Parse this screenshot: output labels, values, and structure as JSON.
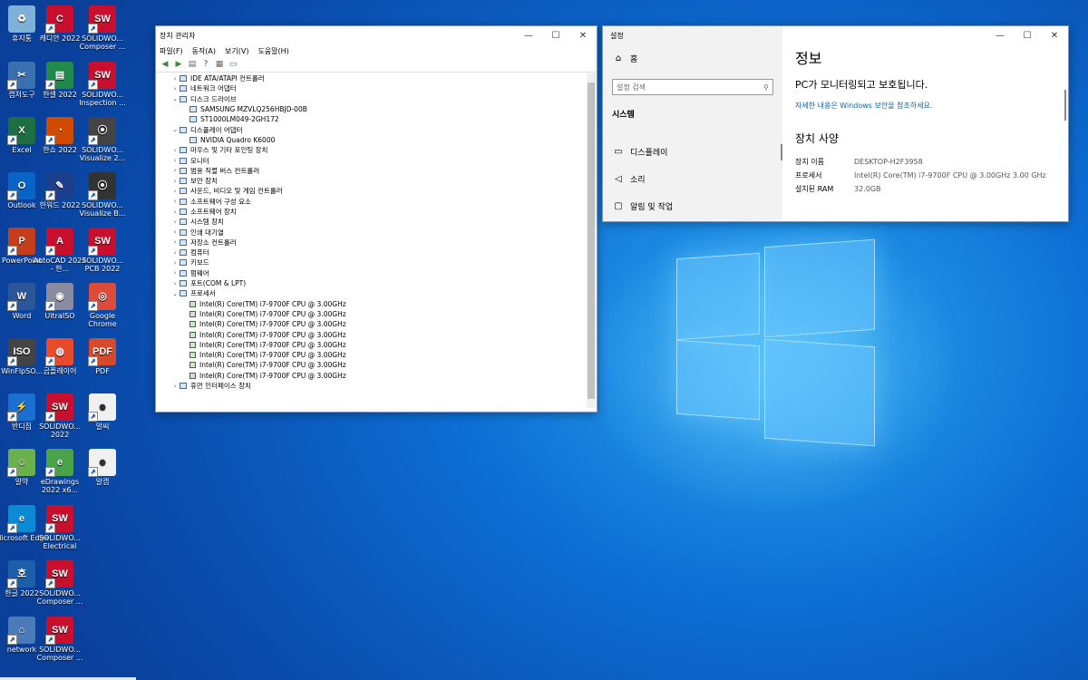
{
  "desktop_icons": [
    {
      "label": "휴지통",
      "color": "#7fb0d8",
      "text": "♻"
    },
    {
      "label": "캐디안 2022",
      "color": "#c8102e",
      "text": "C"
    },
    {
      "label": "SOLIDWO... Composer ...",
      "color": "#c8102e",
      "text": "SW"
    },
    {
      "label": "캡처도구",
      "color": "#3a6fb0",
      "text": "✂"
    },
    {
      "label": "한셀 2022",
      "color": "#1f8a4c",
      "text": "▤"
    },
    {
      "label": "SOLIDWO... Inspection ...",
      "color": "#c8102e",
      "text": "SW"
    },
    {
      "label": "Excel",
      "color": "#1d6f42",
      "text": "X"
    },
    {
      "label": "한쇼 2022",
      "color": "#d04a02",
      "text": "◔"
    },
    {
      "label": "SOLIDWO... Visualize 2...",
      "color": "#444444",
      "text": "⦿"
    },
    {
      "label": "Outlook",
      "color": "#0a64c8",
      "text": "O"
    },
    {
      "label": "한워드 2022",
      "color": "#1c3f8c",
      "text": "✎"
    },
    {
      "label": "SOLIDWO... Visualize B...",
      "color": "#333333",
      "text": "⦿"
    },
    {
      "label": "PowerPoint",
      "color": "#c43e1c",
      "text": "P"
    },
    {
      "label": "AutoCAD 2024 - 한...",
      "color": "#c8102e",
      "text": "A"
    },
    {
      "label": "SOLIDWO... PCB 2022",
      "color": "#c8102e",
      "text": "SW"
    },
    {
      "label": "Word",
      "color": "#2b579a",
      "text": "W"
    },
    {
      "label": "UltraISO",
      "color": "#8a8aa0",
      "text": "◉"
    },
    {
      "label": "Google Chrome",
      "color": "#dd4b39",
      "text": "◎"
    },
    {
      "label": "WinFlpSO...",
      "color": "#444444",
      "text": "ISO"
    },
    {
      "label": "곰플레이어",
      "color": "#e84a2a",
      "text": "◍"
    },
    {
      "label": "PDF",
      "color": "#d44a2a",
      "text": "PDF"
    },
    {
      "label": "반디집",
      "color": "#1a6fd0",
      "text": "⚡"
    },
    {
      "label": "SOLIDWO... 2022",
      "color": "#c8102e",
      "text": "SW"
    },
    {
      "label": "알씨",
      "color": "#f0f0f0",
      "text": "☻"
    },
    {
      "label": "알약",
      "color": "#6ab04c",
      "text": "☺"
    },
    {
      "label": "eDrawings 2022 x6...",
      "color": "#4aa34a",
      "text": "e"
    },
    {
      "label": "알캡",
      "color": "#f0f0f0",
      "text": "☻"
    },
    {
      "label": "Microsoft Edge",
      "color": "#0c8ad6",
      "text": "e"
    },
    {
      "label": "SOLIDWO... Electrical",
      "color": "#c8102e",
      "text": "SW"
    },
    {
      "label": "한글 2022",
      "color": "#1c5fa8",
      "text": "호"
    },
    {
      "label": "SOLIDWO... Composer ...",
      "color": "#c8102e",
      "text": "SW"
    },
    {
      "label": "network",
      "color": "#4a7ab8",
      "text": "⌂"
    },
    {
      "label": "SOLIDWO... Composer ...",
      "color": "#c8102e",
      "text": "SW"
    }
  ],
  "device_manager": {
    "title": "장치 관리자",
    "menus": [
      "파일(F)",
      "동작(A)",
      "보기(V)",
      "도움말(H)"
    ],
    "tree": [
      {
        "label": "IDE ATA/ATAPI 컨트롤러",
        "level": 0,
        "expanded": false
      },
      {
        "label": "네트워크 어댑터",
        "level": 0,
        "expanded": false
      },
      {
        "label": "디스크 드라이브",
        "level": 0,
        "expanded": true
      },
      {
        "label": "SAMSUNG MZVLQ256HBJD-00B",
        "level": 1
      },
      {
        "label": "ST1000LM049-2GH172",
        "level": 1
      },
      {
        "label": "디스플레이 어댑터",
        "level": 0,
        "expanded": true
      },
      {
        "label": "NVIDIA Quadro K6000",
        "level": 1
      },
      {
        "label": "마우스 및 기타 포인팅 장치",
        "level": 0,
        "expanded": false
      },
      {
        "label": "모니터",
        "level": 0,
        "expanded": false
      },
      {
        "label": "범용 직렬 버스 컨트롤러",
        "level": 0,
        "expanded": false
      },
      {
        "label": "보안 장치",
        "level": 0,
        "expanded": false
      },
      {
        "label": "사운드, 비디오 및 게임 컨트롤러",
        "level": 0,
        "expanded": false
      },
      {
        "label": "소프트웨어 구성 요소",
        "level": 0,
        "expanded": false
      },
      {
        "label": "소프트웨어 장치",
        "level": 0,
        "expanded": false
      },
      {
        "label": "시스템 장치",
        "level": 0,
        "expanded": false
      },
      {
        "label": "인쇄 대기열",
        "level": 0,
        "expanded": false
      },
      {
        "label": "저장소 컨트롤러",
        "level": 0,
        "expanded": false
      },
      {
        "label": "컴퓨터",
        "level": 0,
        "expanded": false
      },
      {
        "label": "키보드",
        "level": 0,
        "expanded": false
      },
      {
        "label": "펌웨어",
        "level": 0,
        "expanded": false
      },
      {
        "label": "포트(COM & LPT)",
        "level": 0,
        "expanded": false
      },
      {
        "label": "프로세서",
        "level": 0,
        "expanded": true
      },
      {
        "label": "Intel(R) Core(TM) i7-9700F CPU @ 3.00GHz",
        "level": 1,
        "cpu": true
      },
      {
        "label": "Intel(R) Core(TM) i7-9700F CPU @ 3.00GHz",
        "level": 1,
        "cpu": true
      },
      {
        "label": "Intel(R) Core(TM) i7-9700F CPU @ 3.00GHz",
        "level": 1,
        "cpu": true
      },
      {
        "label": "Intel(R) Core(TM) i7-9700F CPU @ 3.00GHz",
        "level": 1,
        "cpu": true
      },
      {
        "label": "Intel(R) Core(TM) i7-9700F CPU @ 3.00GHz",
        "level": 1,
        "cpu": true
      },
      {
        "label": "Intel(R) Core(TM) i7-9700F CPU @ 3.00GHz",
        "level": 1,
        "cpu": true
      },
      {
        "label": "Intel(R) Core(TM) i7-9700F CPU @ 3.00GHz",
        "level": 1,
        "cpu": true
      },
      {
        "label": "Intel(R) Core(TM) i7-9700F CPU @ 3.00GHz",
        "level": 1,
        "cpu": true
      },
      {
        "label": "휴먼 인터페이스 장치",
        "level": 0,
        "expanded": false
      }
    ]
  },
  "settings": {
    "title": "설정",
    "home": "홈",
    "search_placeholder": "설정 검색",
    "section": "시스템",
    "nav": [
      {
        "label": "디스플레이",
        "icon": "display-icon",
        "glyph": "▭"
      },
      {
        "label": "소리",
        "icon": "speaker-icon",
        "glyph": "◁"
      },
      {
        "label": "알림 및 작업",
        "icon": "notification-icon",
        "glyph": "▢"
      }
    ],
    "page_title": "정보",
    "protect_msg": "PC가 모니터링되고 보호됩니다.",
    "link": "자세한 내용은 Windows 보안을 참조하세요.",
    "specs_title": "장치 사양",
    "specs": [
      {
        "k": "장치 이름",
        "v": "DESKTOP-H2F3958"
      },
      {
        "k": "프로세서",
        "v": "Intel(R) Core(TM) i7-9700F CPU @ 3.00GHz   3.00 GHz"
      },
      {
        "k": "설치된 RAM",
        "v": "32.0GB"
      }
    ],
    "accent": "#0067c0"
  }
}
